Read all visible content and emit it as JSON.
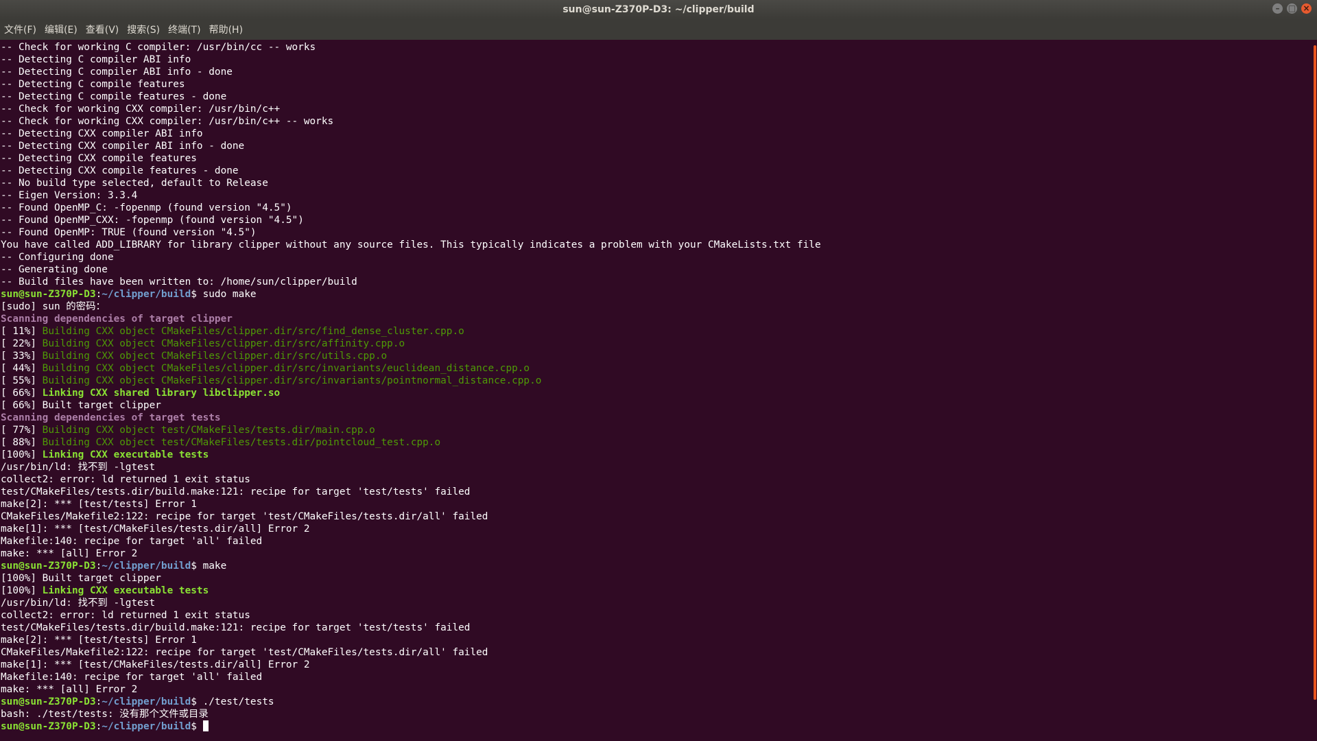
{
  "window": {
    "title": "sun@sun-Z370P-D3: ~/clipper/build"
  },
  "menu": [
    {
      "label": "文件(F)"
    },
    {
      "label": "编辑(E)"
    },
    {
      "label": "查看(V)"
    },
    {
      "label": "搜索(S)"
    },
    {
      "label": "终端(T)"
    },
    {
      "label": "帮助(H)"
    }
  ],
  "colors": {
    "background": "#300a24",
    "prompt_user": "#8ae234",
    "prompt_path": "#729fcf",
    "build_green": "#4e9a06",
    "link_green": "#8ae234",
    "scan_purple": "#ad7fa8",
    "scrollbar": "#e95420"
  },
  "terminal": {
    "lines": [
      [
        {
          "t": "-- Check for working C compiler: /usr/bin/cc -- works"
        }
      ],
      [
        {
          "t": "-- Detecting C compiler ABI info"
        }
      ],
      [
        {
          "t": "-- Detecting C compiler ABI info - done"
        }
      ],
      [
        {
          "t": "-- Detecting C compile features"
        }
      ],
      [
        {
          "t": "-- Detecting C compile features - done"
        }
      ],
      [
        {
          "t": "-- Check for working CXX compiler: /usr/bin/c++"
        }
      ],
      [
        {
          "t": "-- Check for working CXX compiler: /usr/bin/c++ -- works"
        }
      ],
      [
        {
          "t": "-- Detecting CXX compiler ABI info"
        }
      ],
      [
        {
          "t": "-- Detecting CXX compiler ABI info - done"
        }
      ],
      [
        {
          "t": "-- Detecting CXX compile features"
        }
      ],
      [
        {
          "t": "-- Detecting CXX compile features - done"
        }
      ],
      [
        {
          "t": "-- No build type selected, default to Release"
        }
      ],
      [
        {
          "t": "-- Eigen Version: 3.3.4"
        }
      ],
      [
        {
          "t": "-- Found OpenMP_C: -fopenmp (found version \"4.5\")"
        }
      ],
      [
        {
          "t": "-- Found OpenMP_CXX: -fopenmp (found version \"4.5\")"
        }
      ],
      [
        {
          "t": "-- Found OpenMP: TRUE (found version \"4.5\")"
        }
      ],
      [
        {
          "t": "You have called ADD_LIBRARY for library clipper without any source files. This typically indicates a problem with your CMakeLists.txt file"
        }
      ],
      [
        {
          "t": "-- Configuring done"
        }
      ],
      [
        {
          "t": "-- Generating done"
        }
      ],
      [
        {
          "t": "-- Build files have been written to: /home/sun/clipper/build"
        }
      ],
      [
        {
          "t": "sun@sun-Z370P-D3",
          "s": "user"
        },
        {
          "t": ":"
        },
        {
          "t": "~/clipper/build",
          "s": "path"
        },
        {
          "t": "$ sudo make"
        }
      ],
      [
        {
          "t": "[sudo] sun 的密码："
        }
      ],
      [
        {
          "t": "Scanning dependencies of target clipper",
          "s": "purple"
        }
      ],
      [
        {
          "t": "[ 11%] "
        },
        {
          "t": "Building CXX object CMakeFiles/clipper.dir/src/find_dense_cluster.cpp.o",
          "s": "green"
        }
      ],
      [
        {
          "t": "[ 22%] "
        },
        {
          "t": "Building CXX object CMakeFiles/clipper.dir/src/affinity.cpp.o",
          "s": "green"
        }
      ],
      [
        {
          "t": "[ 33%] "
        },
        {
          "t": "Building CXX object CMakeFiles/clipper.dir/src/utils.cpp.o",
          "s": "green"
        }
      ],
      [
        {
          "t": "[ 44%] "
        },
        {
          "t": "Building CXX object CMakeFiles/clipper.dir/src/invariants/euclidean_distance.cpp.o",
          "s": "green"
        }
      ],
      [
        {
          "t": "[ 55%] "
        },
        {
          "t": "Building CXX object CMakeFiles/clipper.dir/src/invariants/pointnormal_distance.cpp.o",
          "s": "green"
        }
      ],
      [
        {
          "t": "[ 66%] "
        },
        {
          "t": "Linking CXX shared library libclipper.so",
          "s": "greenb"
        }
      ],
      [
        {
          "t": "[ 66%] Built target clipper"
        }
      ],
      [
        {
          "t": "Scanning dependencies of target tests",
          "s": "purple"
        }
      ],
      [
        {
          "t": "[ 77%] "
        },
        {
          "t": "Building CXX object test/CMakeFiles/tests.dir/main.cpp.o",
          "s": "green"
        }
      ],
      [
        {
          "t": "[ 88%] "
        },
        {
          "t": "Building CXX object test/CMakeFiles/tests.dir/pointcloud_test.cpp.o",
          "s": "green"
        }
      ],
      [
        {
          "t": "[100%] "
        },
        {
          "t": "Linking CXX executable tests",
          "s": "greenb"
        }
      ],
      [
        {
          "t": "/usr/bin/ld: 找不到 -lgtest"
        }
      ],
      [
        {
          "t": "collect2: error: ld returned 1 exit status"
        }
      ],
      [
        {
          "t": "test/CMakeFiles/tests.dir/build.make:121: recipe for target 'test/tests' failed"
        }
      ],
      [
        {
          "t": "make[2]: *** [test/tests] Error 1"
        }
      ],
      [
        {
          "t": "CMakeFiles/Makefile2:122: recipe for target 'test/CMakeFiles/tests.dir/all' failed"
        }
      ],
      [
        {
          "t": "make[1]: *** [test/CMakeFiles/tests.dir/all] Error 2"
        }
      ],
      [
        {
          "t": "Makefile:140: recipe for target 'all' failed"
        }
      ],
      [
        {
          "t": "make: *** [all] Error 2"
        }
      ],
      [
        {
          "t": "sun@sun-Z370P-D3",
          "s": "user"
        },
        {
          "t": ":"
        },
        {
          "t": "~/clipper/build",
          "s": "path"
        },
        {
          "t": "$ make"
        }
      ],
      [
        {
          "t": "[100%] Built target clipper"
        }
      ],
      [
        {
          "t": "[100%] "
        },
        {
          "t": "Linking CXX executable tests",
          "s": "greenb"
        }
      ],
      [
        {
          "t": "/usr/bin/ld: 找不到 -lgtest"
        }
      ],
      [
        {
          "t": "collect2: error: ld returned 1 exit status"
        }
      ],
      [
        {
          "t": "test/CMakeFiles/tests.dir/build.make:121: recipe for target 'test/tests' failed"
        }
      ],
      [
        {
          "t": "make[2]: *** [test/tests] Error 1"
        }
      ],
      [
        {
          "t": "CMakeFiles/Makefile2:122: recipe for target 'test/CMakeFiles/tests.dir/all' failed"
        }
      ],
      [
        {
          "t": "make[1]: *** [test/CMakeFiles/tests.dir/all] Error 2"
        }
      ],
      [
        {
          "t": "Makefile:140: recipe for target 'all' failed"
        }
      ],
      [
        {
          "t": "make: *** [all] Error 2"
        }
      ],
      [
        {
          "t": "sun@sun-Z370P-D3",
          "s": "user"
        },
        {
          "t": ":"
        },
        {
          "t": "~/clipper/build",
          "s": "path"
        },
        {
          "t": "$ ./test/tests"
        }
      ],
      [
        {
          "t": "bash: ./test/tests: 没有那个文件或目录"
        }
      ],
      [
        {
          "t": "sun@sun-Z370P-D3",
          "s": "user"
        },
        {
          "t": ":"
        },
        {
          "t": "~/clipper/build",
          "s": "path"
        },
        {
          "t": "$ "
        },
        {
          "s": "cursor"
        }
      ]
    ]
  }
}
